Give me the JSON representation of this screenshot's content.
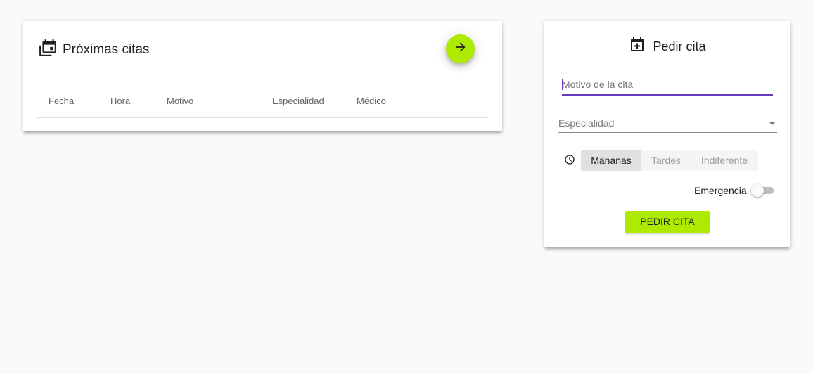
{
  "upcoming": {
    "title": "Próximas citas",
    "columns": [
      "Fecha",
      "Hora",
      "Motivo",
      "Especialidad",
      "Médico"
    ],
    "rows": []
  },
  "request": {
    "title": "Pedir cita",
    "motivo_placeholder": "Motivo de la cita",
    "motivo_value": "",
    "especialidad_label": "Especialidad",
    "shift_options": [
      "Mananas",
      "Tardes",
      "Indiferente"
    ],
    "shift_selected": "Mananas",
    "emergency_label": "Emergencia",
    "emergency_on": false,
    "submit_label": "PEDIR CITA"
  },
  "colors": {
    "accent": "#aeea00",
    "focus": "#673ab7",
    "background": "#fafafa"
  },
  "icons": {
    "upcoming": "calendar-multiple-icon",
    "request": "calendar-plus-icon",
    "fab": "arrow-right-icon",
    "shift": "clock-icon"
  }
}
